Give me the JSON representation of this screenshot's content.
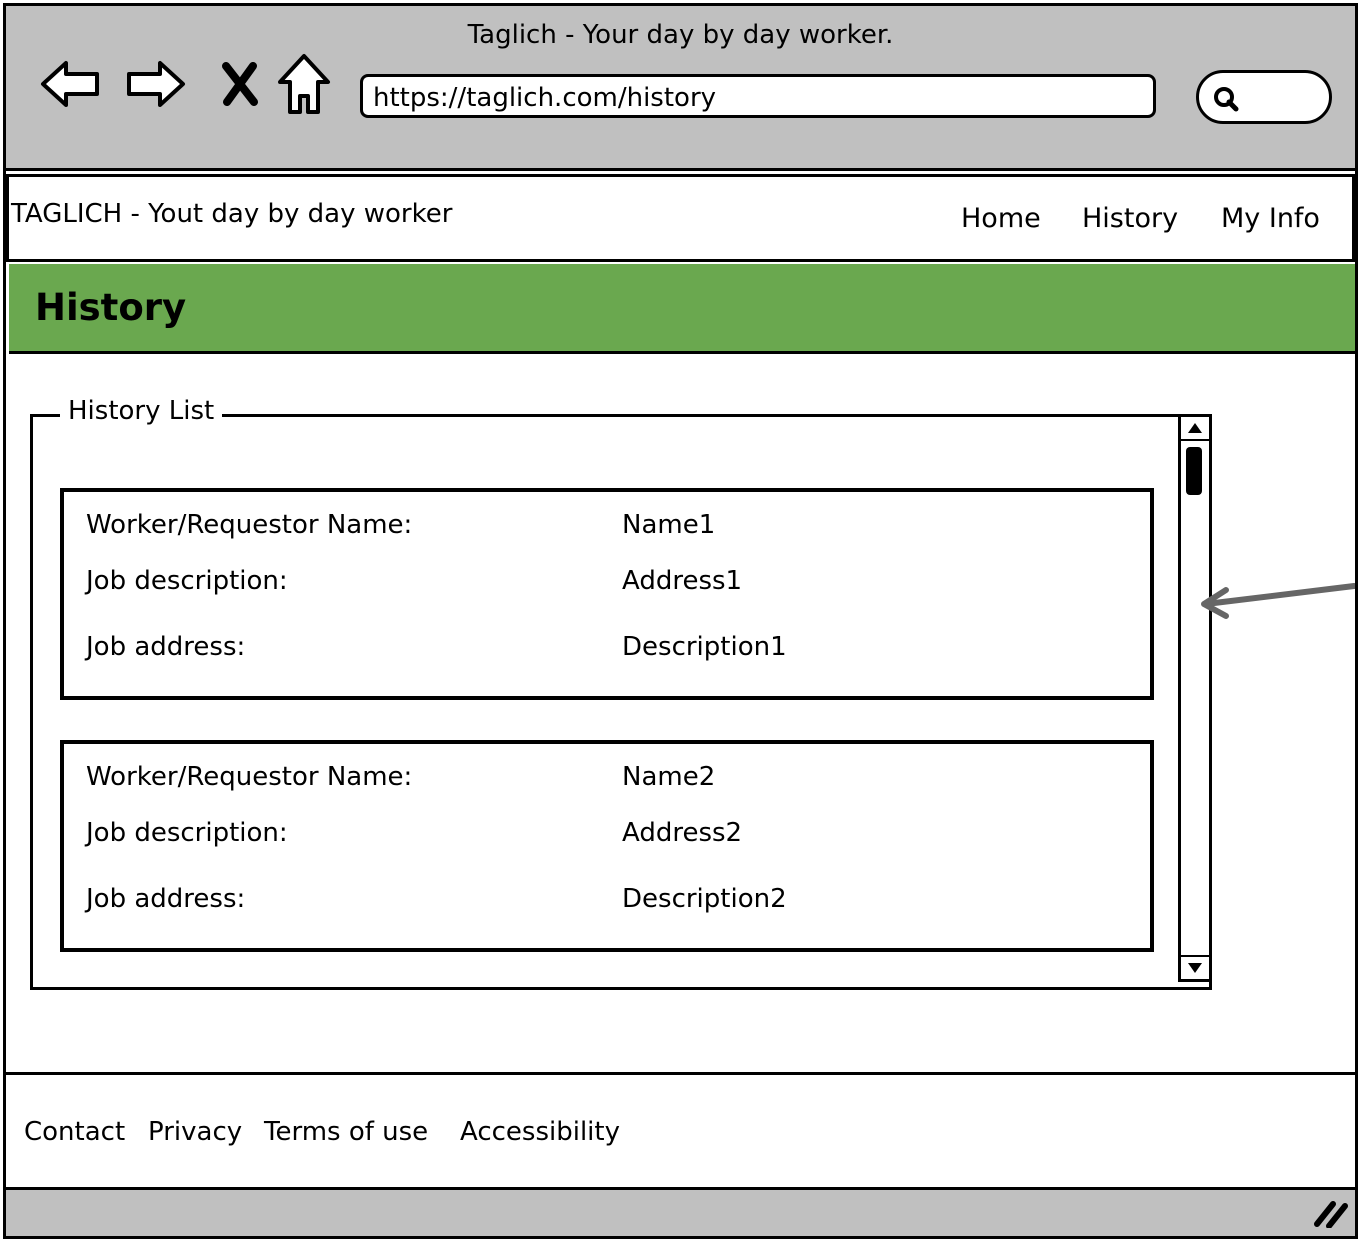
{
  "browser": {
    "window_title": "Taglich - Your day by day worker.",
    "url": "https://taglich.com/history",
    "search_placeholder": "",
    "buttons": [
      "back-icon",
      "forward-icon",
      "close-icon",
      "home-icon"
    ]
  },
  "header": {
    "brand": "TAGLICH - Yout day by day worker",
    "menu": [
      "Home",
      "History",
      "My Info"
    ]
  },
  "page": {
    "title": "History",
    "title_band_color": "#6aa84f"
  },
  "history_list": {
    "legend": "History List",
    "items": [
      {
        "labels": [
          "Worker/Requestor Name:",
          "Job description:",
          "Job address:"
        ],
        "values": [
          "Name1",
          "Address1",
          "Description1"
        ]
      },
      {
        "labels": [
          "Worker/Requestor Name:",
          "Job description:",
          "Job address:"
        ],
        "values": [
          "Name2",
          "Address2",
          "Description2"
        ]
      }
    ]
  },
  "footer": {
    "links": [
      "Contact",
      "Privacy",
      "Terms of use",
      "Accessibility"
    ]
  },
  "chrome_color": "#c0c0c0"
}
